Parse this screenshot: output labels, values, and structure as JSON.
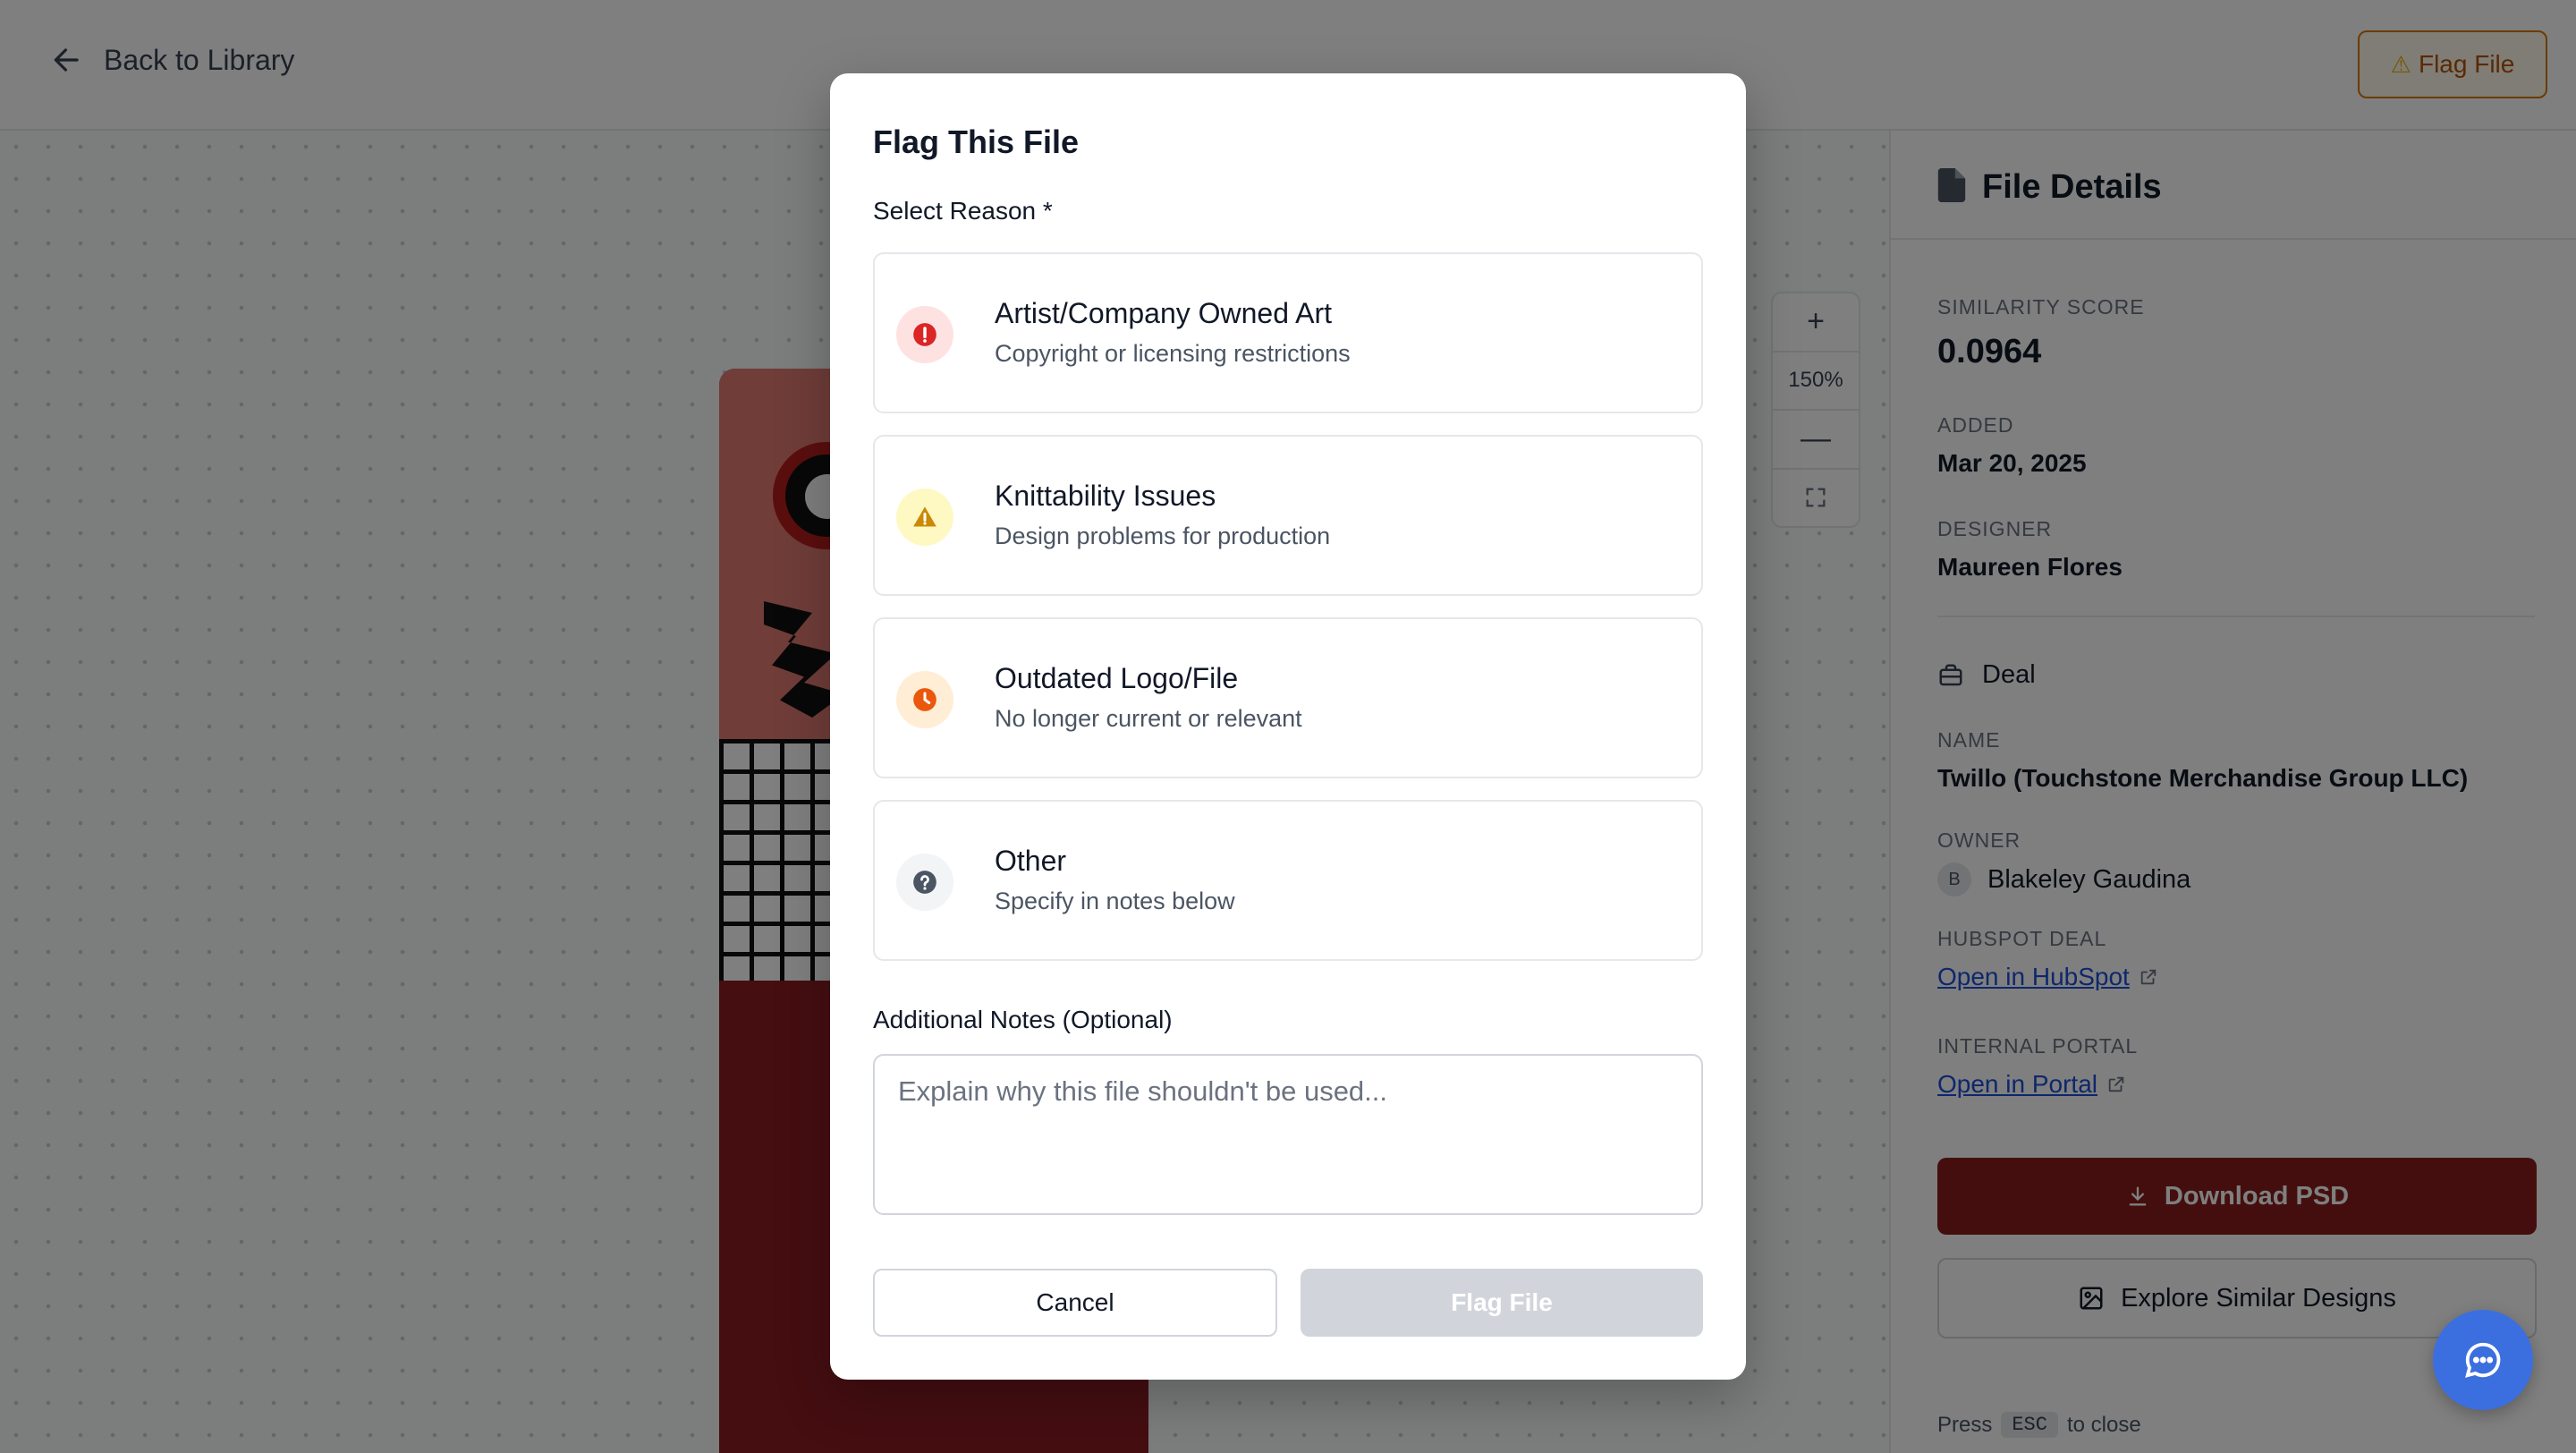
{
  "topbar": {
    "back_label": "Back to Library",
    "flag_label": "Flag File"
  },
  "zoom": {
    "plus": "+",
    "level": "150%",
    "minus": "—"
  },
  "sidebar": {
    "title": "File Details",
    "similarity_label": "SIMILARITY SCORE",
    "similarity_value": "0.0964",
    "added_label": "ADDED",
    "added_value": "Mar 20, 2025",
    "designer_label": "DESIGNER",
    "designer_value": "Maureen Flores",
    "deal_heading": "Deal",
    "name_label": "NAME",
    "name_value": "Twillo (Touchstone Merchandise Group LLC)",
    "owner_label": "OWNER",
    "owner_initial": "B",
    "owner_value": "Blakeley Gaudina",
    "hubspot_label": "HUBSPOT DEAL",
    "hubspot_link": "Open in HubSpot",
    "portal_label": "INTERNAL PORTAL",
    "portal_link": "Open in Portal",
    "download_label": "Download PSD",
    "explore_label": "Explore Similar Designs",
    "esc_press": "Press",
    "esc_key": "ESC",
    "esc_suffix": "to close"
  },
  "modal": {
    "title": "Flag This File",
    "reason_label": "Select Reason *",
    "reasons": [
      {
        "title": "Artist/Company Owned Art",
        "description": "Copyright or licensing restrictions",
        "icon": "alert-circle-icon",
        "color": "#dc2626",
        "bg": "#fee2e2"
      },
      {
        "title": "Knittability Issues",
        "description": "Design problems for production",
        "icon": "warning-triangle-icon",
        "color": "#ca8a04",
        "bg": "#fef9c3"
      },
      {
        "title": "Outdated Logo/File",
        "description": "No longer current or relevant",
        "icon": "clock-icon",
        "color": "#ea580c",
        "bg": "#ffedd5"
      },
      {
        "title": "Other",
        "description": "Specify in notes below",
        "icon": "question-circle-icon",
        "color": "#4b5563",
        "bg": "#f3f4f6"
      }
    ],
    "notes_label": "Additional Notes (Optional)",
    "notes_placeholder": "Explain why this file shouldn't be used...",
    "notes_value": "",
    "cancel_label": "Cancel",
    "submit_label": "Flag File"
  }
}
